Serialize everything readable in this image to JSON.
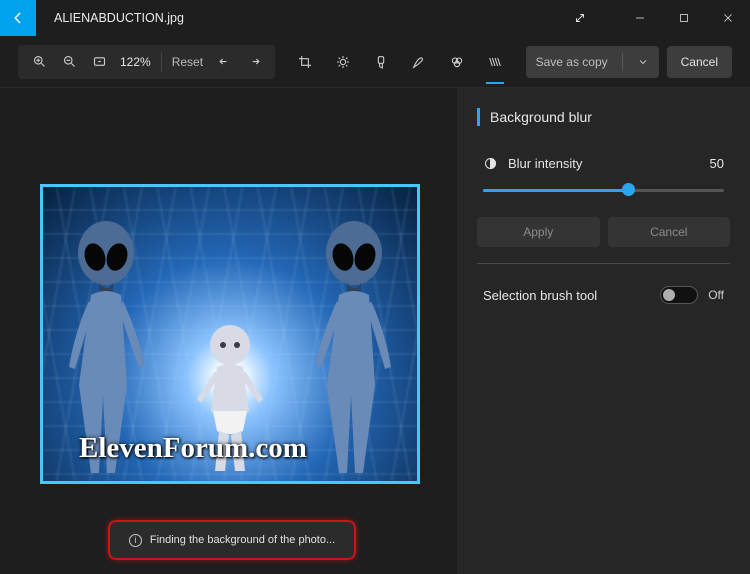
{
  "file_name": "ALIENABDUCTION.jpg",
  "toolbar": {
    "zoom_percent": "122%",
    "reset_label": "Reset",
    "save_label": "Save as copy",
    "cancel_label": "Cancel"
  },
  "panel": {
    "title": "Background blur",
    "blur_label": "Blur intensity",
    "blur_value": "50",
    "apply_label": "Apply",
    "cancel_label": "Cancel",
    "brush_label": "Selection brush tool",
    "brush_state_label": "Off",
    "slider_percent": 60
  },
  "status": {
    "message": "Finding the background of the photo..."
  },
  "watermark": "ElevenForum.com"
}
